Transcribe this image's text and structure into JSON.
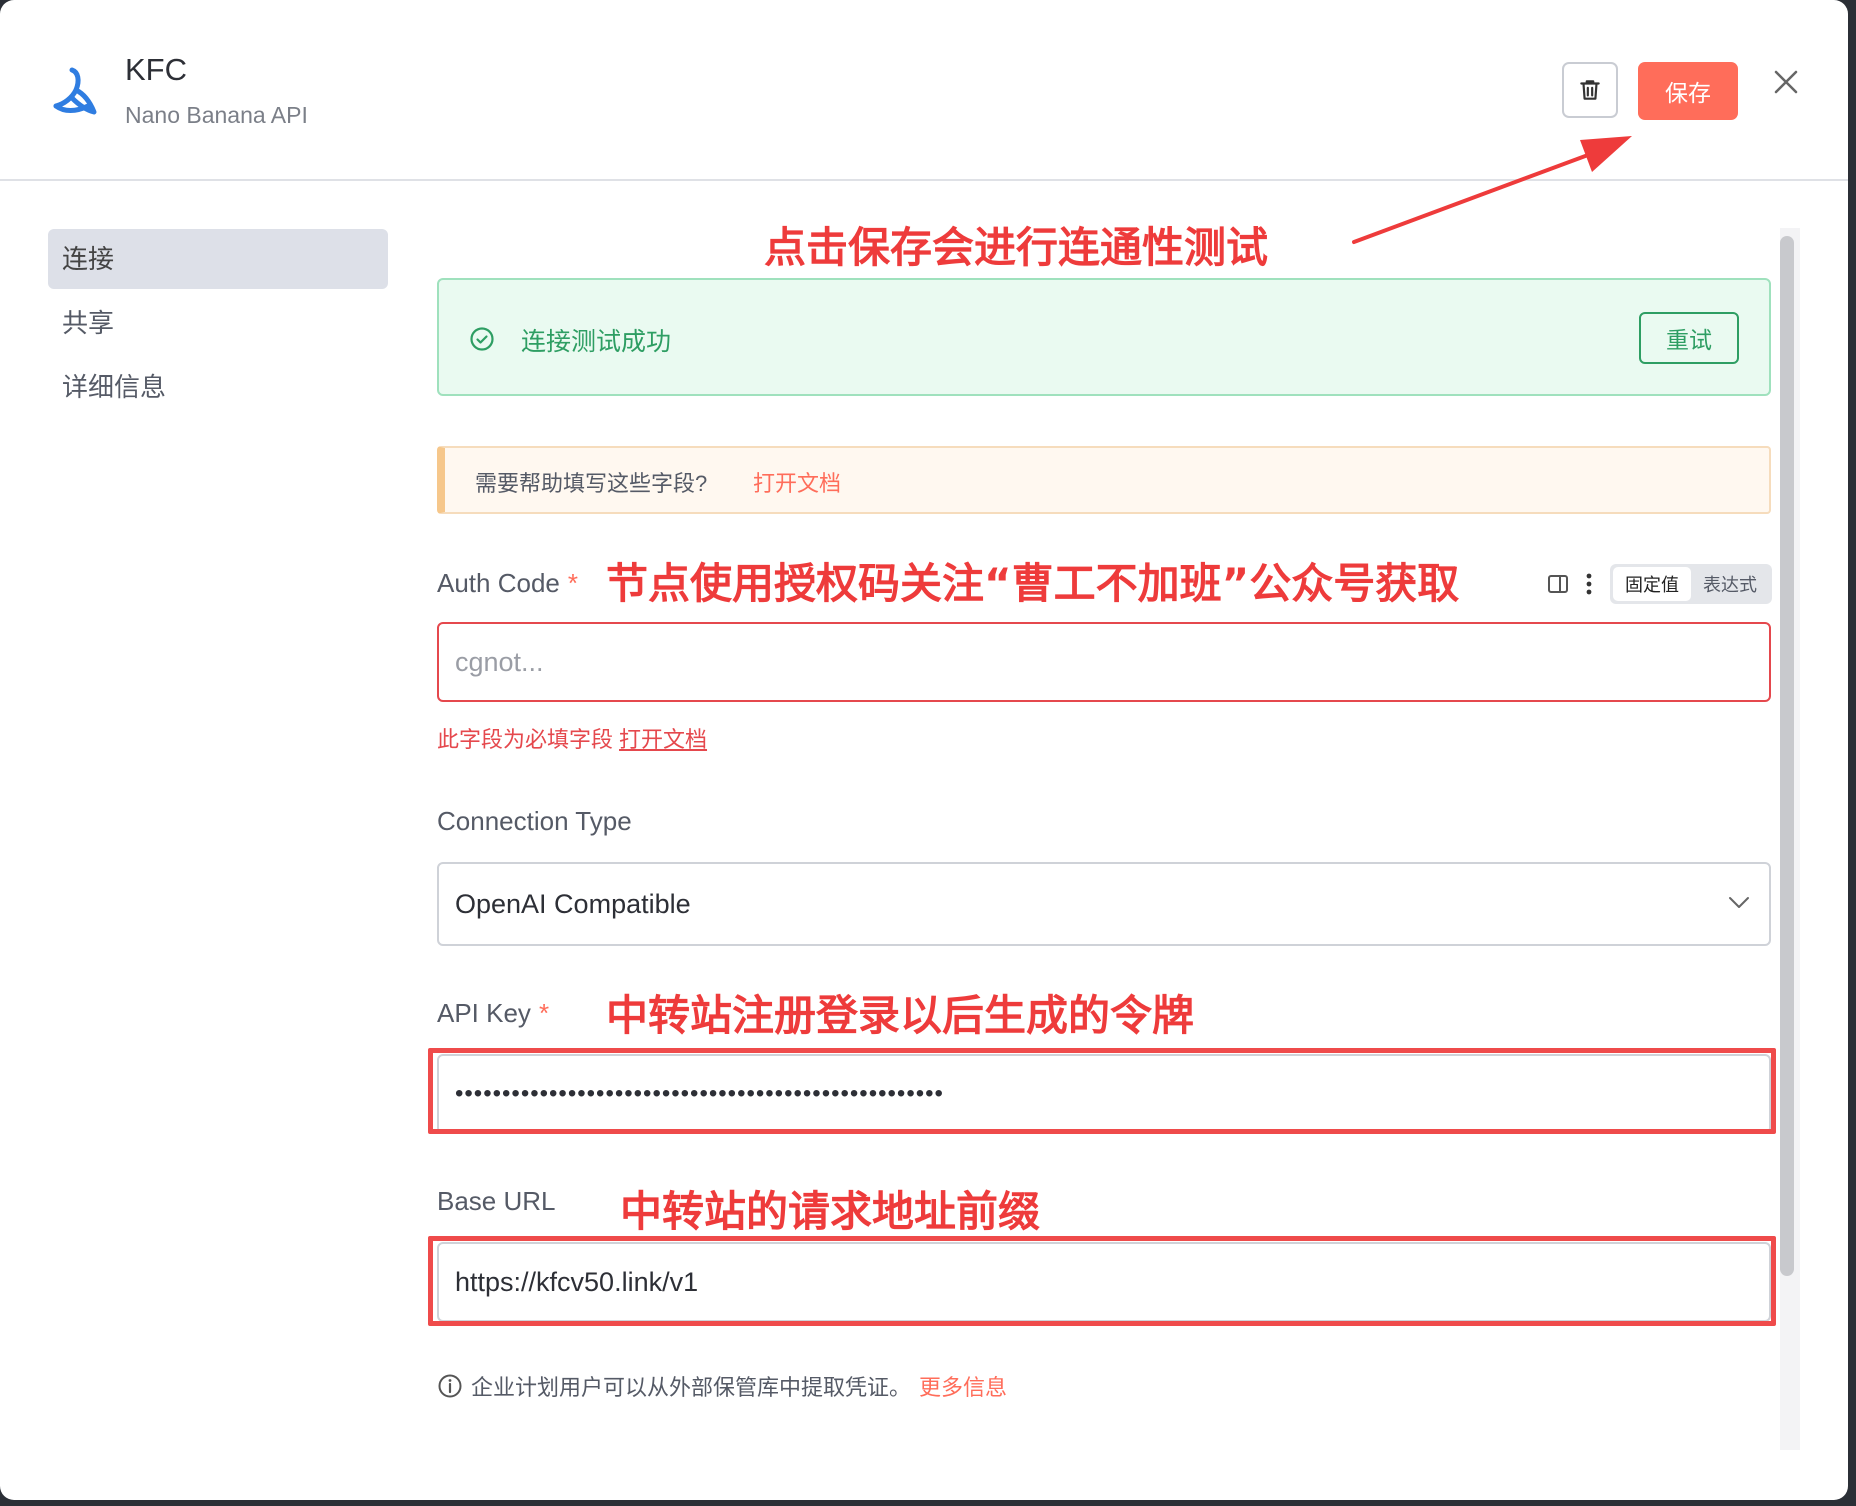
{
  "header": {
    "title": "KFC",
    "subtitle": "Nano Banana API",
    "save_label": "保存"
  },
  "sidebar": {
    "items": [
      {
        "label": "连接",
        "active": true
      },
      {
        "label": "共享",
        "active": false
      },
      {
        "label": "详细信息",
        "active": false
      }
    ]
  },
  "status": {
    "success_text": "连接测试成功",
    "retry_label": "重试"
  },
  "help": {
    "text": "需要帮助填写这些字段?",
    "link": "打开文档"
  },
  "fields": {
    "auth_code": {
      "label": "Auth Code",
      "required_mark": "*",
      "placeholder": "cgnot...",
      "error_text": "此字段为必填字段",
      "error_link": "打开文档",
      "mode_fixed": "固定值",
      "mode_expression": "表达式"
    },
    "connection_type": {
      "label": "Connection Type",
      "value": "OpenAI Compatible"
    },
    "api_key": {
      "label": "API Key",
      "required_mark": "*",
      "value": "••••••••••••••••••••••••••••••••••••••••••••••••••••"
    },
    "base_url": {
      "label": "Base URL",
      "value": "https://kfcv50.link/v1"
    }
  },
  "info": {
    "text": "企业计划用户可以从外部保管库中提取凭证。",
    "link": "更多信息"
  },
  "annotations": {
    "save_note": "点击保存会进行连通性测试",
    "auth_note": "节点使用授权码关注“曹工不加班”公众号获取",
    "api_key_note": "中转站注册登录以后生成的令牌",
    "base_url_note": "中转站的请求地址前缀"
  },
  "colors": {
    "accent": "#ff6d5a",
    "success": "#2e9e63",
    "error": "#e5484d",
    "annotation": "#ee3b3b"
  }
}
